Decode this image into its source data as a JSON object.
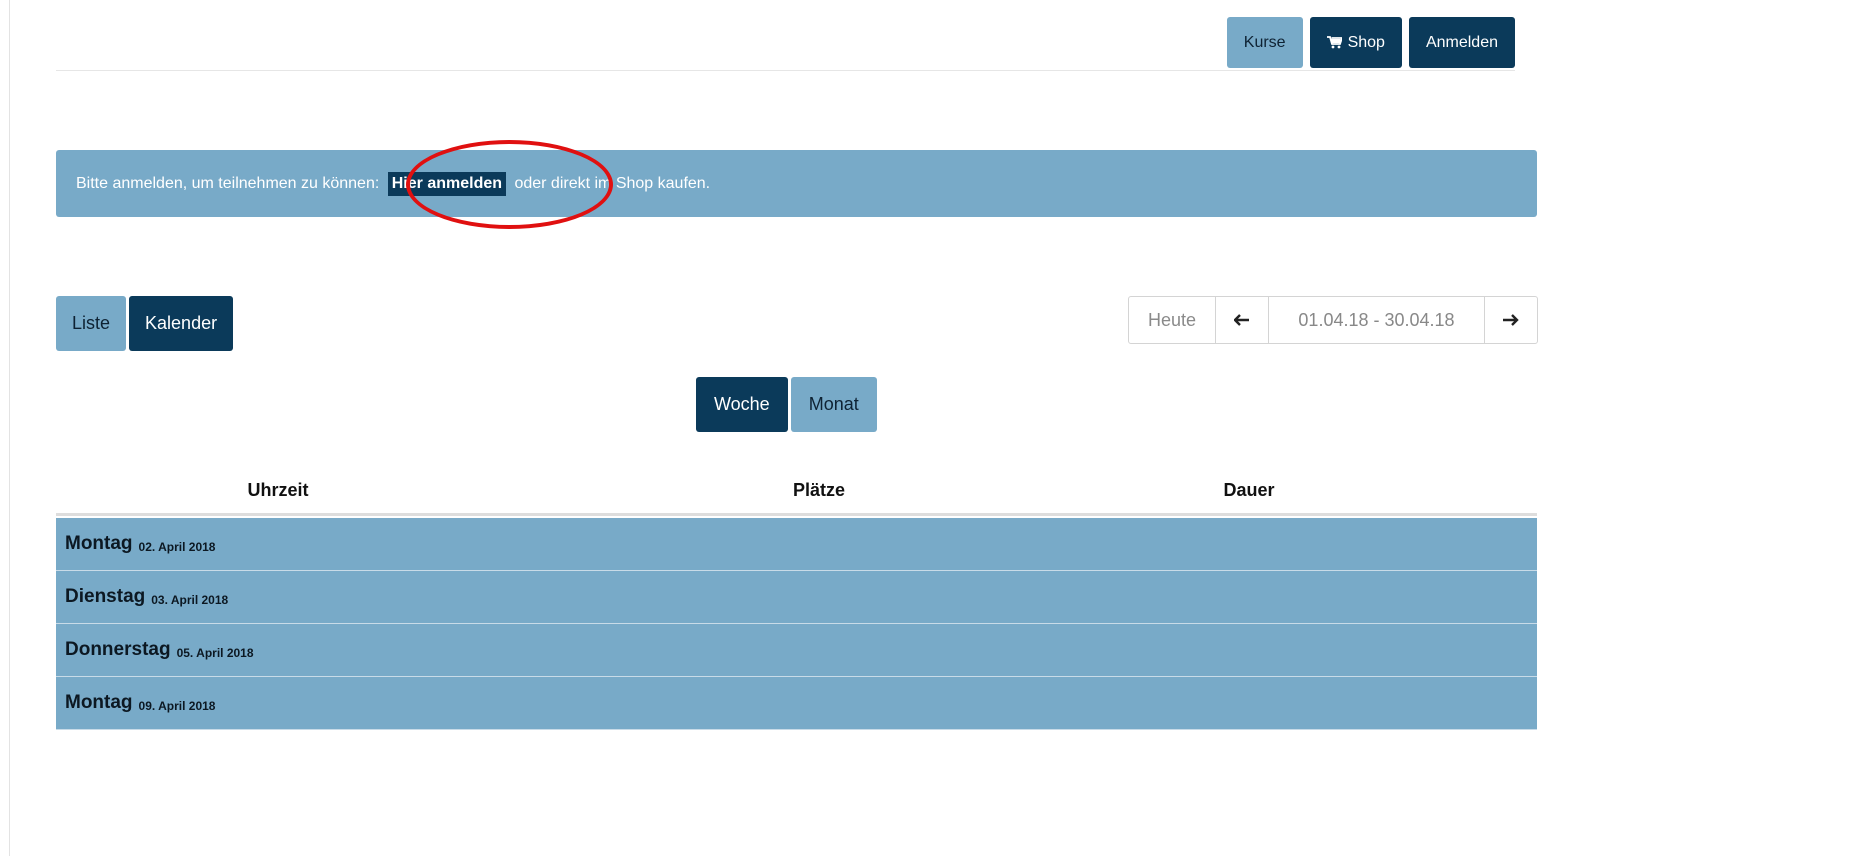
{
  "nav": {
    "kurse": "Kurse",
    "shop": "Shop",
    "anmelden": "Anmelden"
  },
  "alert": {
    "text_before": "Bitte anmelden, um teilnehmen zu können: ",
    "link": "Hier anmelden",
    "text_after": " oder direkt im Shop kaufen."
  },
  "view_toggle": {
    "liste": "Liste",
    "kalender": "Kalender",
    "active": "Kalender"
  },
  "date_nav": {
    "today": "Heute",
    "range": "01.04.18 - 30.04.18"
  },
  "period_toggle": {
    "woche": "Woche",
    "monat": "Monat",
    "active": "Woche"
  },
  "table": {
    "headers": [
      "Uhrzeit",
      "Plätze",
      "Dauer"
    ]
  },
  "days": [
    {
      "name": "Montag",
      "date": "02. April 2018"
    },
    {
      "name": "Dienstag",
      "date": "03. April 2018"
    },
    {
      "name": "Donnerstag",
      "date": "05. April 2018"
    },
    {
      "name": "Montag",
      "date": "09. April 2018"
    }
  ],
  "colors": {
    "light_accent": "#78aac8",
    "dark_accent": "#0b3a5a",
    "annotation_red": "#e01010"
  }
}
